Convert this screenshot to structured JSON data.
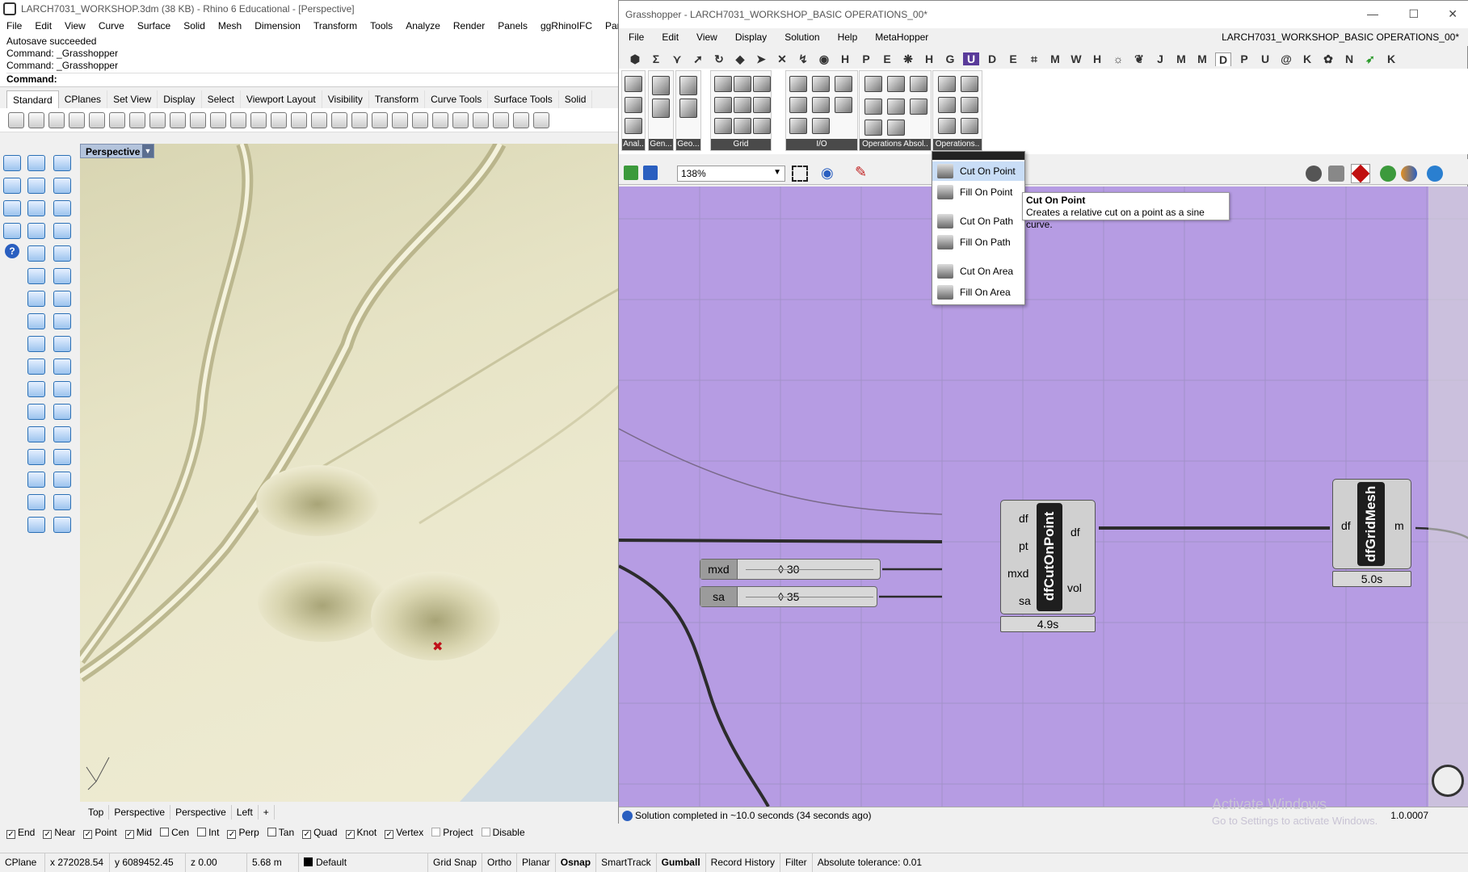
{
  "rhino": {
    "title": "LARCH7031_WORKSHOP.3dm (38 KB) - Rhino 6 Educational - [Perspective]",
    "menu": [
      "File",
      "Edit",
      "View",
      "Curve",
      "Surface",
      "Solid",
      "Mesh",
      "Dimension",
      "Transform",
      "Tools",
      "Analyze",
      "Render",
      "Panels",
      "ggRhinoIFC",
      "Paneling To"
    ],
    "history": [
      "Autosave succeeded",
      "Command: _Grasshopper",
      "Command: _Grasshopper"
    ],
    "command_prompt": "Command:",
    "toolbar_tabs": [
      "Standard",
      "CPlanes",
      "Set View",
      "Display",
      "Select",
      "Viewport Layout",
      "Visibility",
      "Transform",
      "Curve Tools",
      "Surface Tools",
      "Solid"
    ],
    "viewport": {
      "name": "Perspective"
    },
    "viewport_tabs": [
      "Top",
      "Perspective",
      "Perspective",
      "Left",
      "+"
    ],
    "osnaps": [
      {
        "label": "End",
        "checked": true
      },
      {
        "label": "Near",
        "checked": true
      },
      {
        "label": "Point",
        "checked": true
      },
      {
        "label": "Mid",
        "checked": true
      },
      {
        "label": "Cen",
        "checked": false
      },
      {
        "label": "Int",
        "checked": false
      },
      {
        "label": "Perp",
        "checked": true
      },
      {
        "label": "Tan",
        "checked": false
      },
      {
        "label": "Quad",
        "checked": true
      },
      {
        "label": "Knot",
        "checked": true
      },
      {
        "label": "Vertex",
        "checked": true
      },
      {
        "label": "Project",
        "checked": false
      },
      {
        "label": "Disable",
        "checked": false
      }
    ],
    "status": {
      "cplane": "CPlane",
      "x": "x 272028.54",
      "y": "y 6089452.45",
      "z": "z 0.00",
      "units": "5.68 m",
      "layer": "Default",
      "items": [
        "Grid Snap",
        "Ortho",
        "Planar",
        "Osnap",
        "SmartTrack",
        "Gumball",
        "Record History",
        "Filter"
      ],
      "tolerance": "Absolute tolerance: 0.01"
    }
  },
  "grasshopper": {
    "title": "Grasshopper - LARCH7031_WORKSHOP_BASIC OPERATIONS_00*",
    "document": "LARCH7031_WORKSHOP_BASIC OPERATIONS_00*",
    "menu": [
      "File",
      "Edit",
      "View",
      "Display",
      "Solution",
      "Help",
      "MetaHopper"
    ],
    "tab_letters": [
      "Σ",
      "H",
      "P",
      "E",
      "H",
      "G",
      "D",
      "E",
      "M",
      "W",
      "H",
      "J",
      "M",
      "M",
      "D",
      "P",
      "U",
      "@",
      "K",
      "N",
      "K"
    ],
    "ribbon_groups": [
      "Anal..",
      "Gen...",
      "Geo...",
      "Grid",
      "I/O",
      "Operations Absol..",
      "Operations.."
    ],
    "zoom": "138%",
    "dropdown": {
      "items": [
        "Cut On Point",
        "Fill On Point",
        "Cut On Path",
        "Fill On Path",
        "Cut On Area",
        "Fill On Area"
      ],
      "highlighted": "Cut On Point"
    },
    "tooltip": {
      "title": "Cut On Point",
      "text": "Creates a relative cut on a point as a sine curve."
    },
    "sliders": [
      {
        "name": "mxd",
        "value": "30"
      },
      {
        "name": "sa",
        "value": "35"
      }
    ],
    "cut_component": {
      "name": "dfCutOnPoint",
      "inputs": [
        "df",
        "pt",
        "mxd",
        "sa"
      ],
      "outputs": [
        "df",
        "vol"
      ],
      "time": "4.9s"
    },
    "mesh_component": {
      "name": "dfGridMesh",
      "inputs": [
        "df"
      ],
      "outputs": [
        "m"
      ],
      "time": "5.0s"
    },
    "status": "Solution completed in ~10.0 seconds (34 seconds ago)",
    "version": "1.0.0007",
    "watermark": [
      "Activate Windows",
      "Go to Settings to activate Windows."
    ]
  }
}
